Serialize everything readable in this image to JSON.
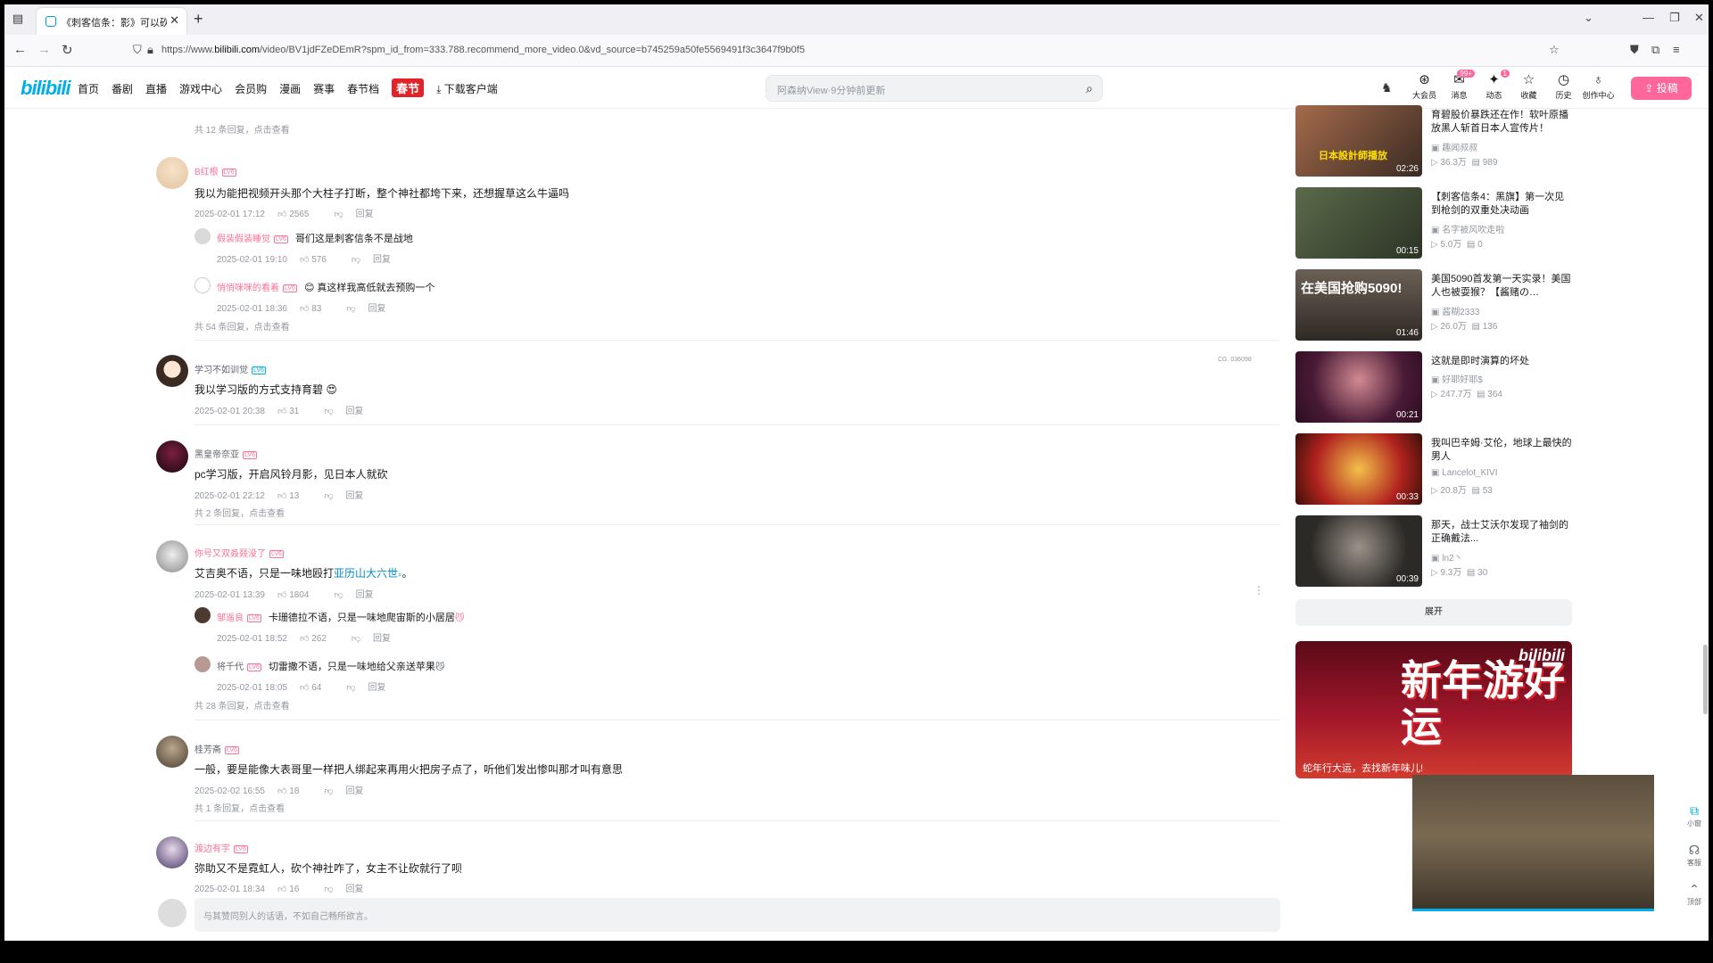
{
  "browser": {
    "tab_title": "《刺客信条：影》可以砍柱子吗",
    "url_prefix": "https://www.",
    "url_domain": "bilibili.com",
    "url_rest": "/video/BV1jdFZeDEmR?spm_id_from=333.788.recommend_more_video.0&vd_source=b745259a50fe5569491f3c3647f9b0f5"
  },
  "header": {
    "logo": "bilibili",
    "nav": [
      "首页",
      "番剧",
      "直播",
      "游戏中心",
      "会员购",
      "漫画",
      "赛事",
      "春节档"
    ],
    "festival_badge": "春节",
    "download": "下载客户端",
    "search_placeholder": "阿森纳View·9分钟前更新",
    "icons": [
      {
        "name": "大会员",
        "glyph": "⊛"
      },
      {
        "name": "消息",
        "glyph": "✉",
        "badge": "99+"
      },
      {
        "name": "动态",
        "glyph": "✦",
        "badge": "1"
      },
      {
        "name": "收藏",
        "glyph": "☆"
      },
      {
        "name": "历史",
        "glyph": "◷"
      },
      {
        "name": "创作中心",
        "glyph": "♁"
      }
    ],
    "upload": "投稿"
  },
  "comments": {
    "top_more": "共 12 条回复，点击查看",
    "c1": {
      "user": "B红根",
      "level": "LV6",
      "text": "我以为能把视频开头那个大柱子打断，整个神社都垮下来，还想握草这么牛逼吗",
      "date": "2025-02-01 17:12",
      "likes": "2565",
      "reply": "回复",
      "subs": [
        {
          "user": "假装假装睡觉",
          "text": "哥们这是刺客信条不是战地",
          "date": "2025-02-01 19:10",
          "likes": "576",
          "reply": "回复"
        },
        {
          "user": "悄悄咪咪的看着",
          "text": "真这样我高低就去预购一个",
          "date": "2025-02-01 18:36",
          "likes": "83",
          "reply": "回复"
        }
      ],
      "more": "共 54 条回复，点击查看"
    },
    "c2": {
      "user": "学习不如训觉",
      "level": "LV6",
      "text": "我以学习版的方式支持育碧",
      "date": "2025-02-01 20:38",
      "likes": "31",
      "reply": "回复",
      "deco": "CG. 036098"
    },
    "c3": {
      "user": "黑皇帝奈亚",
      "level": "LV6",
      "text": "pc学习版，开启风铃月影，见日本人就砍",
      "date": "2025-02-01 22:12",
      "likes": "13",
      "reply": "回复",
      "more": "共 2 条回复，点击查看"
    },
    "c4": {
      "user": "你号又双叒叕没了",
      "level": "LV6",
      "text_before": "艾吉奥不语，只是一味地殴打",
      "link": "亚历山大六世",
      "text_after": "。",
      "date": "2025-02-01 13:39",
      "likes": "1804",
      "reply": "回复",
      "subs": [
        {
          "user": "邹遥良",
          "text": "卡珊德拉不语，只是一味地爬宙斯的小居居",
          "date": "2025-02-01 18:52",
          "likes": "262",
          "reply": "回复"
        },
        {
          "user": "将千代",
          "text": "切雷撒不语，只是一味地给父亲送苹果",
          "date": "2025-02-01 18:05",
          "likes": "64",
          "reply": "回复"
        }
      ],
      "more": "共 28 条回复，点击查看"
    },
    "c5": {
      "user": "桂芳斋",
      "level": "LV6",
      "text": "一般，要是能像大表哥里一样把人绑起来再用火把房子点了，听他们发出惨叫那才叫有意思",
      "date": "2025-02-02 16:55",
      "likes": "18",
      "reply": "回复",
      "more": "共 1 条回复，点击查看"
    },
    "c6": {
      "user": "渡边有宇",
      "level": "LV6",
      "text": "弥助又不是霓虹人，砍个神社咋了，女主不让砍就行了呗",
      "date": "2025-02-01 18:34",
      "likes": "16",
      "reply": "回复"
    },
    "reply_placeholder": "与其赞同别人的话语，不如自己畅所欲言。"
  },
  "recommend": [
    {
      "title": "育碧股价暴跌还在作！软叶原播放黑人斩首日本人宣传片！",
      "up": "趣闻叔叔",
      "views": "36.3万",
      "danmaku": "989",
      "duration": "02:26",
      "overlay": "日本設計師播放"
    },
    {
      "title": "【刺客信条4：黑旗】第一次见到枪剑的双重处决动画",
      "up": "名字被风吹走啦",
      "views": "5.0万",
      "danmaku": "0",
      "duration": "00:15",
      "overlay": ""
    },
    {
      "title": "美国5090首发第一天实录！美国人也被耍猴？【酱赌の…",
      "up": "酱糊2333",
      "views": "26.0万",
      "danmaku": "136",
      "duration": "01:46",
      "overlay": "在美国抢购5090!"
    },
    {
      "title": "这就是即时演算的坏处",
      "up": "好耶好耶$",
      "views": "247.7万",
      "danmaku": "364",
      "duration": "00:21",
      "overlay": ""
    },
    {
      "title": "我叫巴辛姆·艾伦，地球上最快的男人",
      "up": "Lancelot_KIVI",
      "views": "20.8万",
      "danmaku": "53",
      "duration": "00:33",
      "overlay": ""
    },
    {
      "title": "那天，战士艾沃尔发现了袖剑的正确戴法...",
      "up": "ln2丶",
      "views": "9.3万",
      "danmaku": "30",
      "duration": "00:39",
      "overlay": ""
    }
  ],
  "expand": "展开",
  "banner": {
    "big": "新年游好运",
    "caption": "蛇年行大运，去找新年味儿!",
    "logo": "bilibili"
  },
  "float": [
    {
      "label": "小窗",
      "glyph": "⧉"
    },
    {
      "label": "客服",
      "glyph": "☊"
    },
    {
      "label": "顶部",
      "glyph": "⌃"
    }
  ],
  "colors": {
    "accent": "#00aeec",
    "pink": "#fb7299",
    "upload": "#ff6699"
  }
}
